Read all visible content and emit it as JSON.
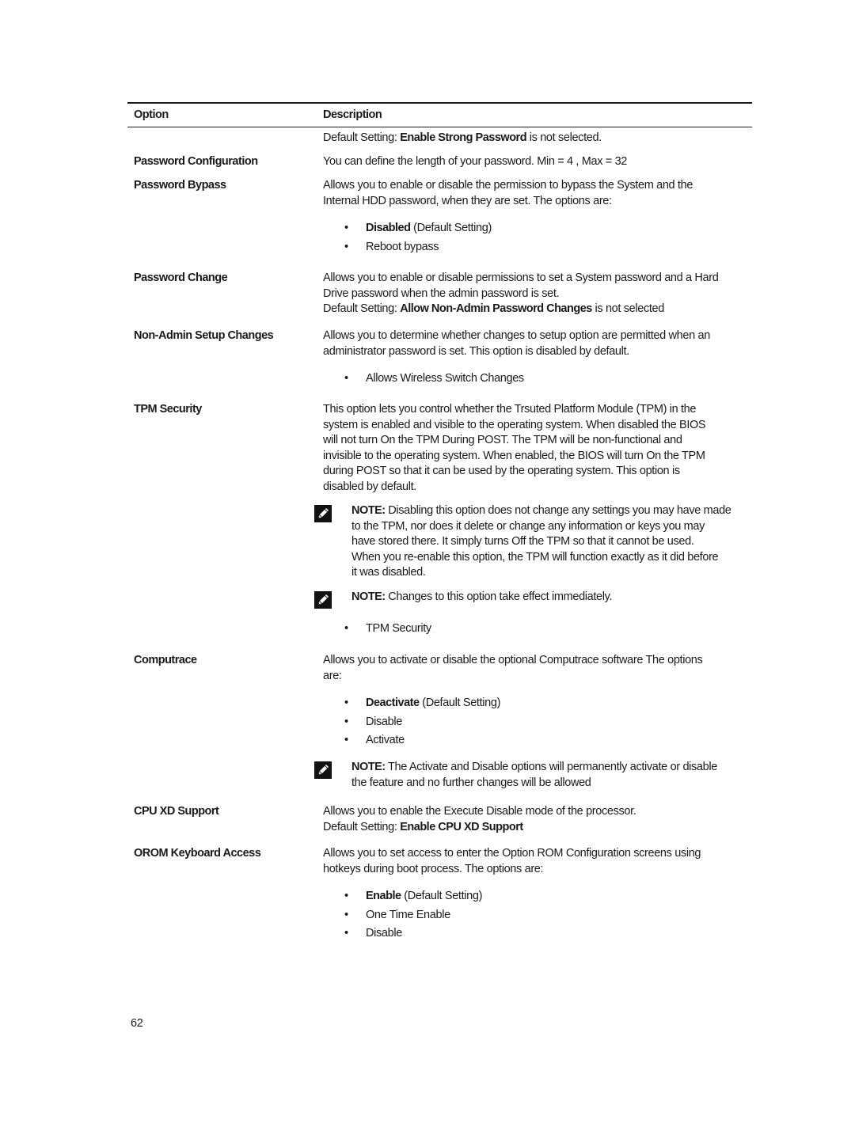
{
  "table": {
    "headers": {
      "option": "Option",
      "description": "Description"
    },
    "rows": [
      {
        "option": "",
        "lines": [
          {
            "parts": [
              {
                "t": "Default Setting: ",
                "b": false
              },
              {
                "t": "Enable Strong Password",
                "b": true
              },
              {
                "t": " is not selected.",
                "b": false
              }
            ]
          }
        ]
      },
      {
        "option": "Password Configuration",
        "lines": [
          {
            "parts": [
              {
                "t": "You can define the length of your password. Min = 4 , Max = 32",
                "b": false
              }
            ]
          }
        ]
      },
      {
        "option": "Password Bypass",
        "lines": [
          {
            "parts": [
              {
                "t": "Allows you to enable or disable the permission to bypass the System and the",
                "b": false
              }
            ]
          },
          {
            "parts": [
              {
                "t": "Internal HDD password, when they are set. The options are:",
                "b": false
              }
            ]
          }
        ],
        "bullets": [
          {
            "bold": "Disabled",
            "rest": " (Default Setting)"
          },
          {
            "bold": "",
            "rest": "Reboot bypass"
          }
        ]
      },
      {
        "option": "Password Change",
        "lines": [
          {
            "parts": [
              {
                "t": "Allows you to enable or disable permissions to set a System password and a Hard",
                "b": false
              }
            ]
          },
          {
            "parts": [
              {
                "t": "Drive password when the admin password is set.",
                "b": false
              }
            ]
          },
          {
            "parts": [
              {
                "t": "Default Setting: ",
                "b": false
              },
              {
                "t": "Allow Non-Admin Password Changes",
                "b": true
              },
              {
                "t": " is not selected",
                "b": false
              }
            ]
          }
        ]
      },
      {
        "option": "Non-Admin Setup Changes",
        "lines": [
          {
            "parts": [
              {
                "t": "Allows you to determine whether changes to setup option are permitted when an",
                "b": false
              }
            ]
          },
          {
            "parts": [
              {
                "t": "administrator password is set. This option is disabled by default.",
                "b": false
              }
            ]
          }
        ],
        "bullets": [
          {
            "bold": "",
            "rest": "Allows Wireless Switch Changes"
          }
        ]
      },
      {
        "option": "TPM Security",
        "lines": [
          {
            "parts": [
              {
                "t": "This option lets you control whether the Trsuted Platform Module (TPM) in the",
                "b": false
              }
            ]
          },
          {
            "parts": [
              {
                "t": "system is enabled and visible to the operating system. When disabled the BIOS",
                "b": false
              }
            ]
          },
          {
            "parts": [
              {
                "t": "will not turn On the TPM During POST. The TPM will be non-functional and",
                "b": false
              }
            ]
          },
          {
            "parts": [
              {
                "t": "invisible to the operating system. When enabled, the BIOS will turn On the TPM",
                "b": false
              }
            ]
          },
          {
            "parts": [
              {
                "t": "during POST so that it can be used by the operating system. This option is",
                "b": false
              }
            ]
          },
          {
            "parts": [
              {
                "t": "disabled by default.",
                "b": false
              }
            ]
          }
        ],
        "notes": [
          {
            "label": "NOTE:",
            "lines": [
              " Disabling this option does not change any settings you may have made",
              "to the TPM, nor does it delete or change any information or keys you may",
              "have stored there. It simply turns Off the TPM so that it cannot be used.",
              "When you re-enable this option, the TPM will function exactly as it did before",
              "it was disabled."
            ]
          },
          {
            "label": "NOTE:",
            "lines": [
              " Changes to this option take effect immediately."
            ]
          }
        ],
        "bullets": [
          {
            "bold": "",
            "rest": "TPM Security"
          }
        ]
      },
      {
        "option": "Computrace",
        "lines": [
          {
            "parts": [
              {
                "t": "Allows you to activate or disable the optional Computrace software The options",
                "b": false
              }
            ]
          },
          {
            "parts": [
              {
                "t": "are:",
                "b": false
              }
            ]
          }
        ],
        "bullets": [
          {
            "bold": "Deactivate",
            "rest": " (Default Setting)"
          },
          {
            "bold": "",
            "rest": "Disable"
          },
          {
            "bold": "",
            "rest": "Activate"
          }
        ],
        "notes": [
          {
            "label": "NOTE:",
            "lines": [
              " The Activate and Disable options will permanently activate or disable",
              "the feature and no further changes will be allowed"
            ]
          }
        ]
      },
      {
        "option": "CPU XD Support",
        "lines": [
          {
            "parts": [
              {
                "t": "Allows you to enable the Execute Disable mode of the processor.",
                "b": false
              }
            ]
          },
          {
            "parts": [
              {
                "t": "Default Setting: ",
                "b": false
              },
              {
                "t": "Enable CPU XD Support",
                "b": true
              }
            ]
          }
        ]
      },
      {
        "option": "OROM Keyboard Access",
        "lines": [
          {
            "parts": [
              {
                "t": "Allows you to set access to enter the Option ROM Configuration screens using",
                "b": false
              }
            ]
          },
          {
            "parts": [
              {
                "t": "hotkeys during boot process. The options are:",
                "b": false
              }
            ]
          }
        ],
        "bullets": [
          {
            "bold": "Enable",
            "rest": " (Default Setting)"
          },
          {
            "bold": "",
            "rest": "One Time Enable"
          },
          {
            "bold": "",
            "rest": "Disable"
          }
        ]
      }
    ]
  },
  "footer": {
    "page_number": "62"
  },
  "icons": {
    "note": "pencil-note-icon",
    "bullet": "•"
  }
}
